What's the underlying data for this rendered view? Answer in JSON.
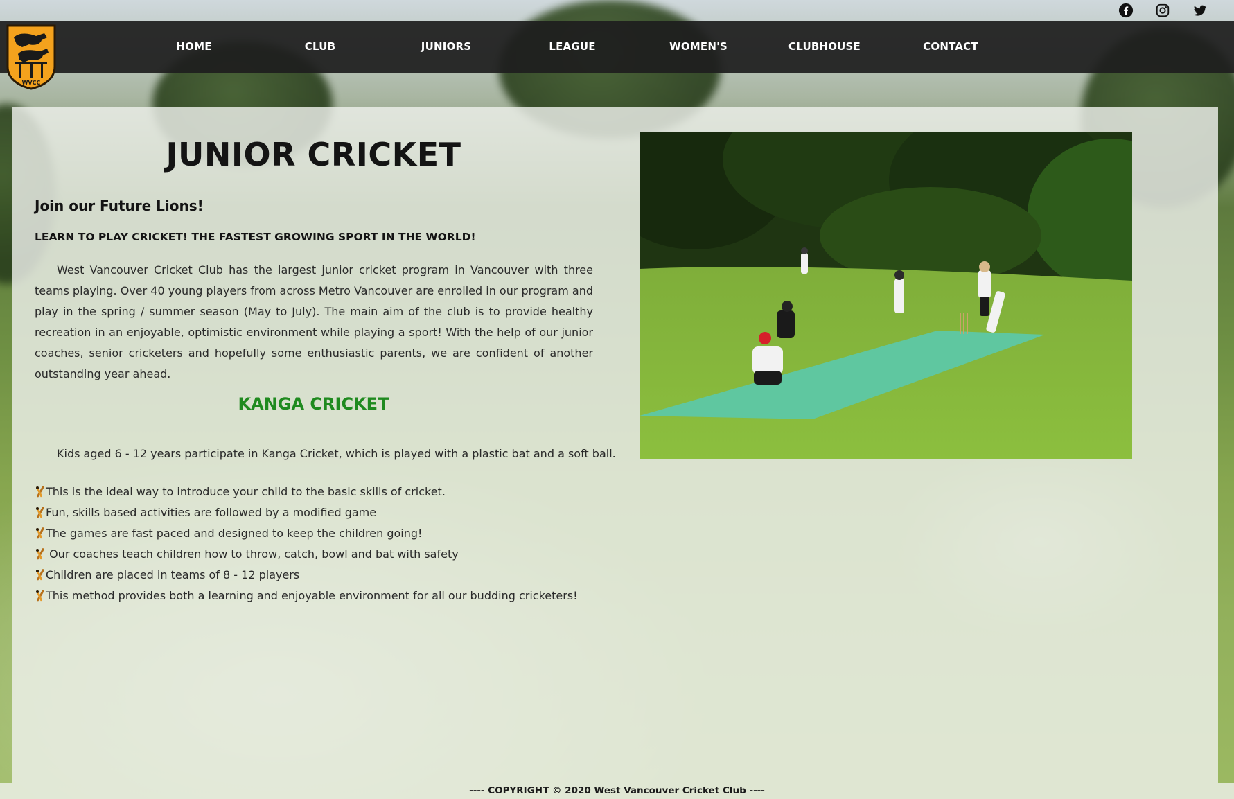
{
  "social": {
    "facebook_icon": "facebook-icon",
    "instagram_icon": "instagram-icon",
    "twitter_icon": "twitter-icon"
  },
  "logo": {
    "letters": "WVCC",
    "color": "#f4a21d"
  },
  "nav": {
    "items": [
      {
        "label": "HOME"
      },
      {
        "label": "CLUB"
      },
      {
        "label": "JUNIORS"
      },
      {
        "label": "LEAGUE"
      },
      {
        "label": "WOMEN'S"
      },
      {
        "label": "CLUBHOUSE"
      },
      {
        "label": "CONTACT"
      }
    ]
  },
  "main": {
    "title": "JUNIOR CRICKET",
    "subtitle": "Join our Future Lions!",
    "tagline": "LEARN TO PLAY CRICKET! THE FASTEST GROWING SPORT IN THE WORLD!",
    "intro": "West Vancouver Cricket Club has the largest junior cricket program in Vancouver with three teams playing. Over 40 young players from across Metro Vancouver are enrolled in our program and play in the spring / summer season (May to July). The main aim of the club is to provide healthy recreation in an enjoyable, optimistic environment while playing a sport! With the help of our junior coaches, senior cricketers and hopefully some enthusiastic parents, we are confident of another outstanding year ahead.",
    "kanga_heading": "KANGA CRICKET",
    "kanga_text": "Kids aged 6 - 12 years participate in Kanga Cricket, which is played with a plastic bat and a soft ball.",
    "bullets": [
      "This is the ideal way to introduce your child to the basic skills of cricket.",
      "Fun, skills based activities are followed by a modified game",
      "The games are fast paced and designed to keep the children going!",
      " Our coaches teach children how to throw, catch, bowl and bat with safety",
      "Children are placed in teams of 8 - 12 players",
      "This method provides both a learning and enjoyable environment for all our budding cricketers!"
    ],
    "kanga_color": "#1f8a1f"
  },
  "footer": {
    "text": "---- COPYRIGHT © 2020 West Vancouver Cricket Club ----"
  }
}
